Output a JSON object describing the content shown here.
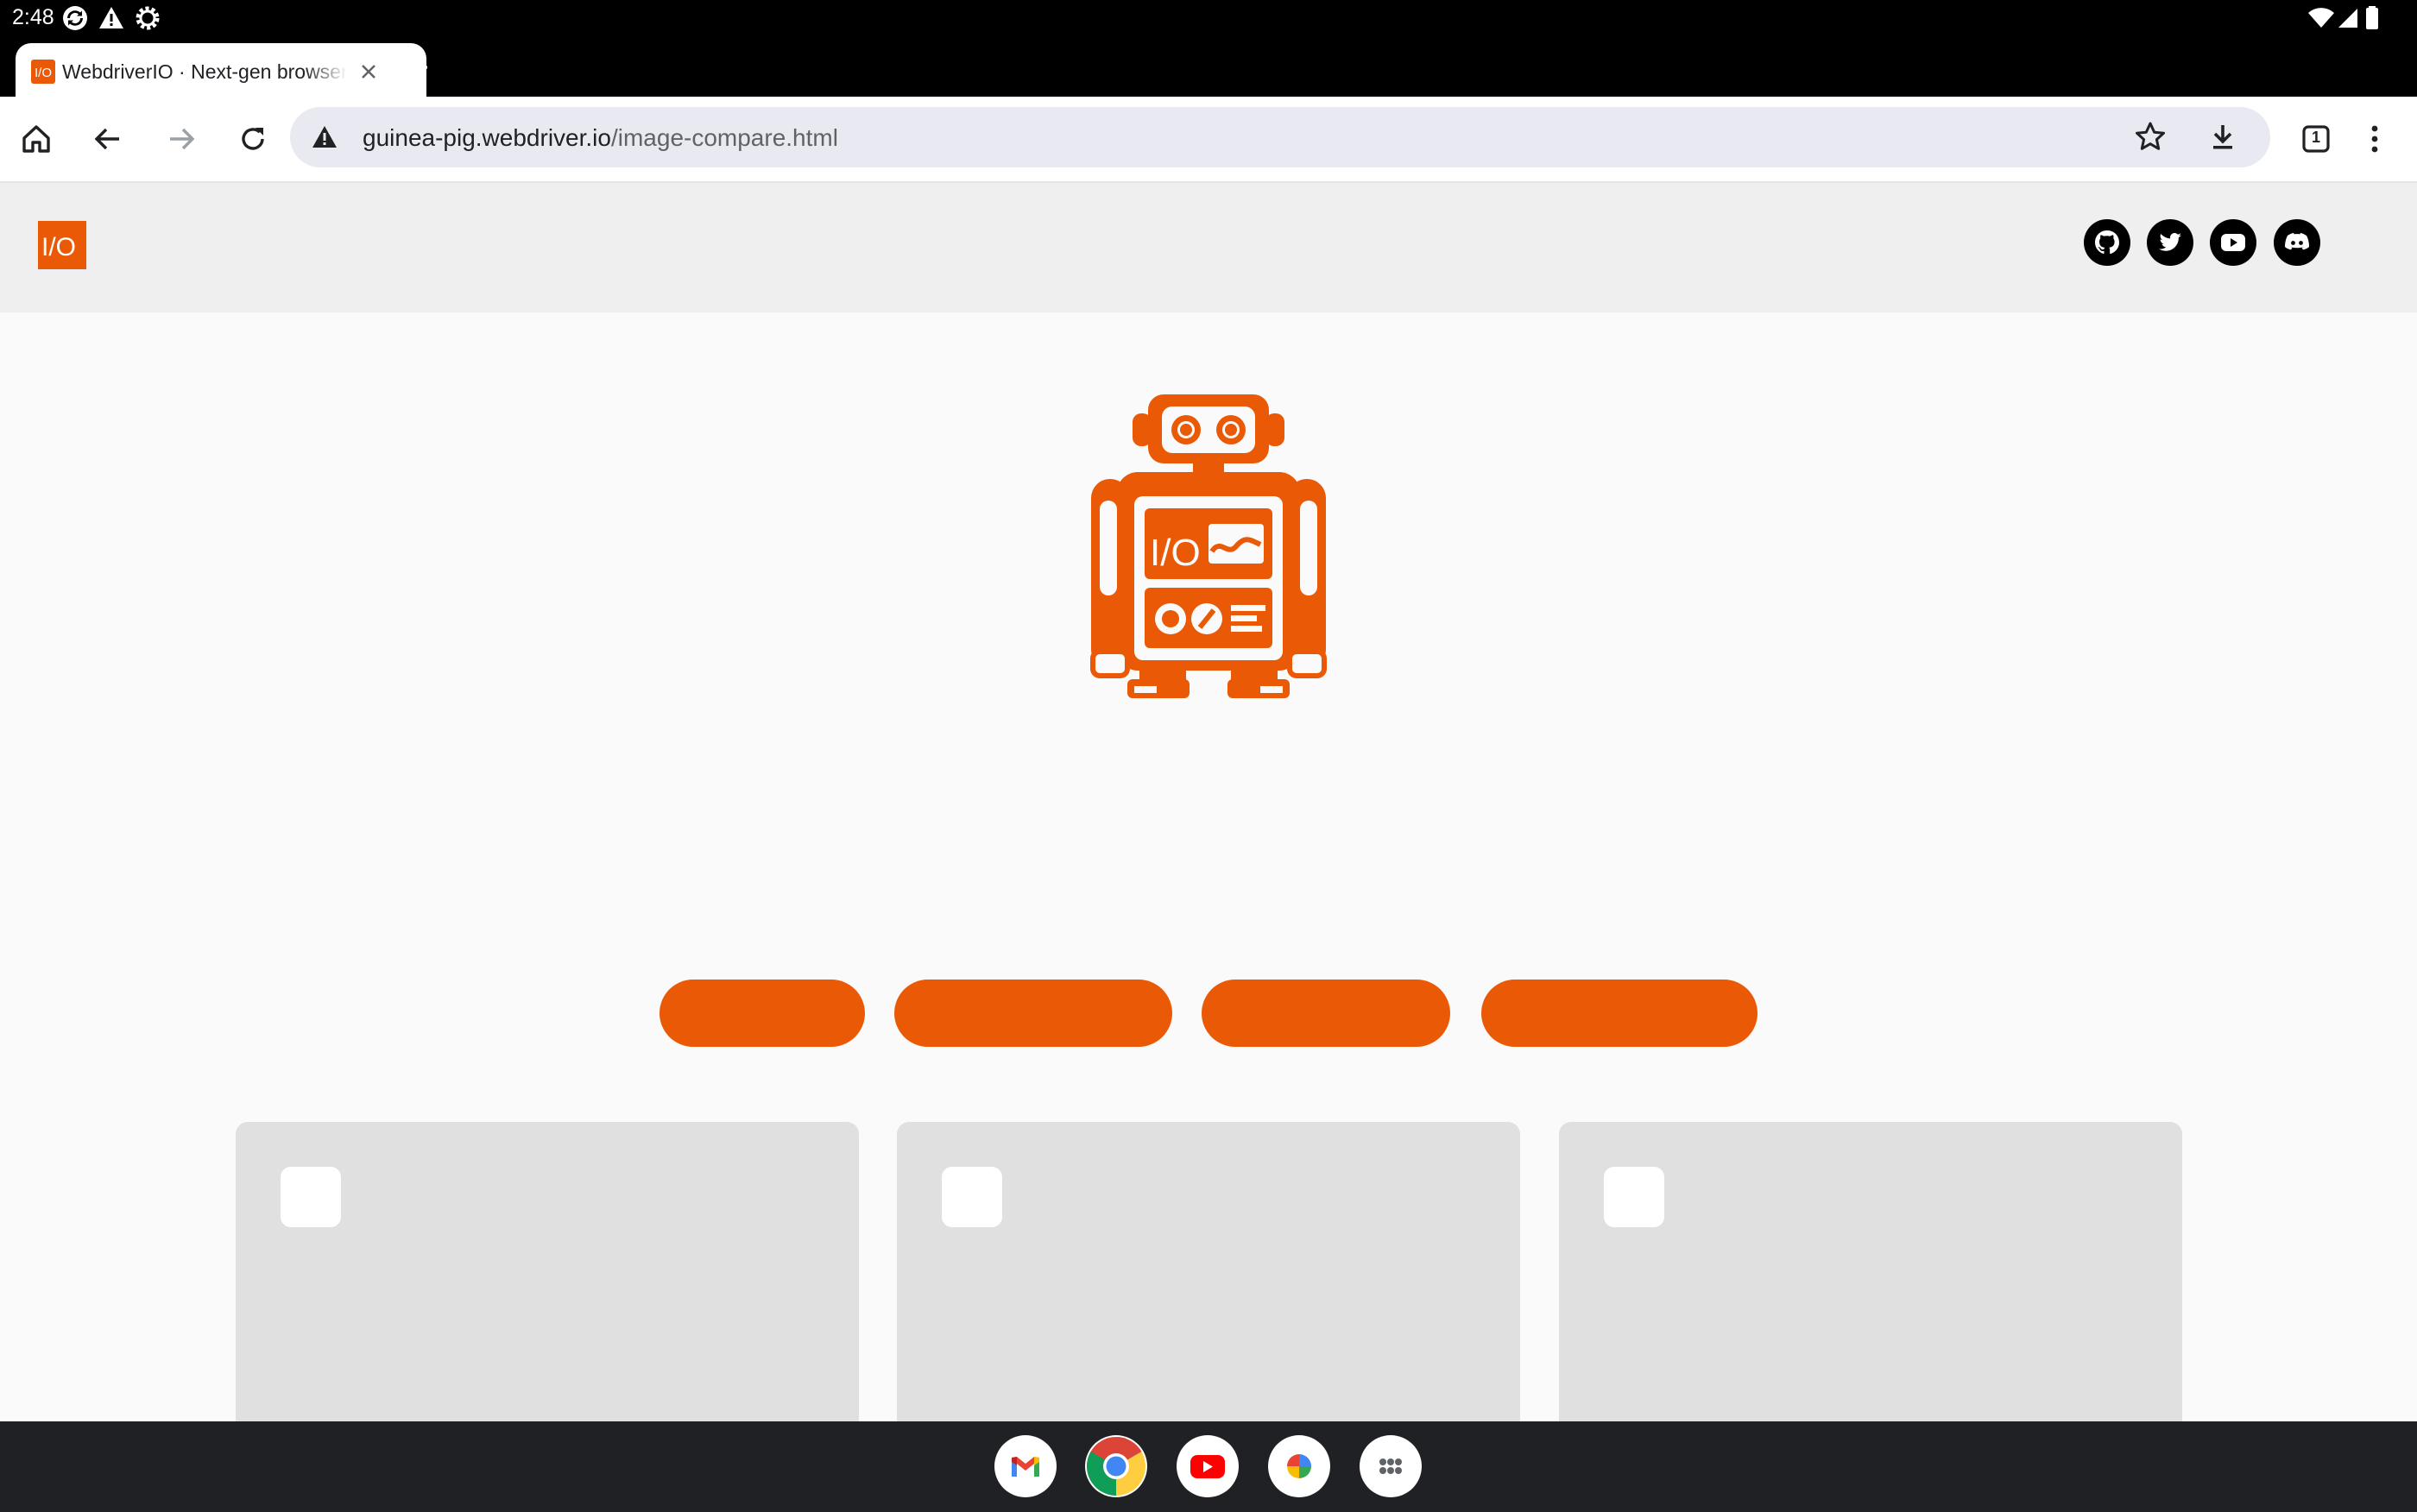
{
  "status_bar": {
    "time": "2:48",
    "left_icons": [
      "sync-icon",
      "alert-icon",
      "settings-icon"
    ],
    "right_icons": [
      "wifi-icon",
      "signal-icon",
      "battery-icon"
    ]
  },
  "browser": {
    "tab": {
      "title": "WebdriverIO · Next-gen browser and mobile automation test framework for Node.js",
      "favicon": "webdriverio-icon"
    },
    "omnibox": {
      "host": "guinea-pig.webdriver.io",
      "path": "/image-compare.html",
      "security_icon": "not-secure-warning-icon"
    },
    "tab_count": "1"
  },
  "site": {
    "logo_text": "I/O",
    "social_icons": [
      "github-icon",
      "twitter-icon",
      "youtube-icon",
      "discord-icon"
    ],
    "robot_logo_text": "I/O",
    "brand_color": "#ea5906",
    "buttons": [
      "",
      "",
      "",
      ""
    ],
    "cards": [
      {},
      {},
      {}
    ]
  },
  "taskbar": {
    "apps": [
      "gmail-icon",
      "chrome-icon",
      "youtube-icon",
      "photos-icon",
      "app-launcher-icon"
    ]
  }
}
